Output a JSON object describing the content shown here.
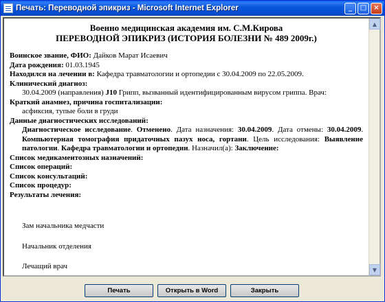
{
  "window": {
    "title": "Печать: Переводной эпикриз - Microsoft Internet Explorer",
    "minimize": "_",
    "maximize": "□",
    "close": "×"
  },
  "document": {
    "header1": "Военно медицинская академия им. С.М.Кирова",
    "header2": "ПЕРЕВОДНОЙ ЭПИКРИЗ (ИСТОРИЯ БОЛЕЗНИ № 489 2009г.)",
    "rank_label": "Воинское звание, ФИО:",
    "rank_value": "Дайков Марат Исаевич",
    "birth_label": "Дата рождения:",
    "birth_value": "01.03.1945",
    "location_label": "Находился на лечении в:",
    "location_value": "Кафедра травматологии и ортопедии с 30.04.2009 по 22.05.2009.",
    "diagnosis_label": "Клинический диагноз:",
    "diagnosis_date": "30.04.2009 (направления)",
    "diagnosis_code": "J10",
    "diagnosis_text": "Грипп, вызванный идентифицированным вирусом гриппа. Врач:",
    "anamnesis_label": "Краткий анамнез, причина госпитализации:",
    "anamnesis_value": "асфиксия, тупые боли в груди",
    "diag_studies_label": "Данные диагностических исследований:",
    "study": {
      "name": "Диагностическое исследование",
      "status": "Отменено",
      "date_label": "Дата назначения:",
      "date_value": "30.04.2009",
      "cancel_label": "Дата отмены:",
      "cancel_value": "30.04.2009",
      "type": "Компьютерная томография придаточных пазух носа, гортани",
      "goal_label": "Цель исследования:",
      "goal_value": "Выявление патологии",
      "dept": "Кафедра травматологии и ортопедии",
      "assigned_label": "Назначил(а):",
      "conclusion_label": "Заключение:"
    },
    "med_list": "Список медикаментозных назначений:",
    "ops_list": "Список операций:",
    "consult_list": "Список консультаций:",
    "proc_list": "Список процедур:",
    "results_label": "Результаты лечения:",
    "sign1": "Зам начальника медчасти",
    "sign2": "Начальник отделения",
    "sign3": "Лечащий врач"
  },
  "buttons": {
    "print": "Печать",
    "open_word": "Открыть в Word",
    "close": "Закрыть"
  }
}
